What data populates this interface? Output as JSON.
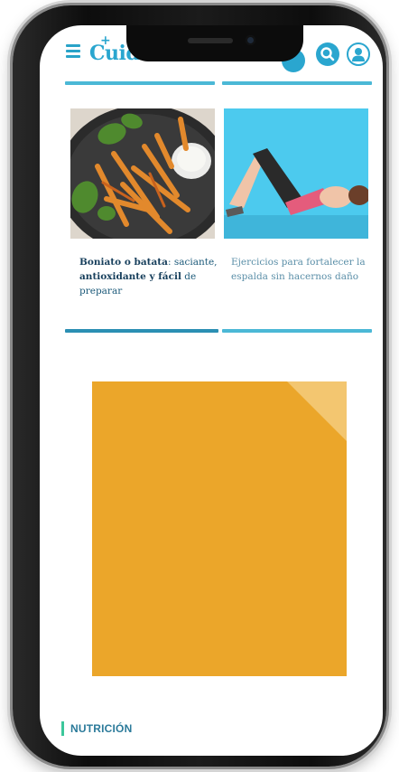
{
  "header": {
    "logo_text": "Cuid",
    "logo_plus": "+"
  },
  "articles": [
    {
      "title_bold": "Boniato o batata",
      "title_mid": ": saciante, ",
      "title_bold2": "antioxidante y fácil",
      "title_rest": " de preparar"
    },
    {
      "title": "Ejercicios para fortalecer la espalda sin hacernos daño"
    }
  ],
  "section": {
    "label": "NUTRICIÓN"
  },
  "colors": {
    "brand": "#2aa6cf",
    "rule": "#4bb8d6",
    "ad": "#eba62a",
    "section_bar": "#3cc79b"
  }
}
